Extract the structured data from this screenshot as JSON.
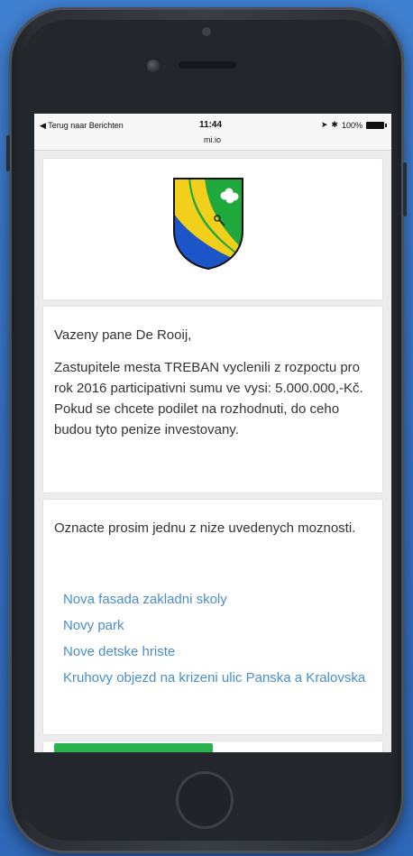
{
  "status_bar": {
    "back_label": "◀ Terug naar Berichten",
    "time": "11:44",
    "host": "mi.io",
    "battery_label": "100%"
  },
  "logo": {
    "name": "municipal-crest"
  },
  "message": {
    "greeting": "Vazeny pane De Rooij,",
    "body": "Zastupitele mesta TREBAN vyclenili z rozpoctu pro rok 2016 participativni sumu ve vysi: 5.000.000,-Kč. Pokud se chcete podilet na rozhodnuti, do ceho budou tyto penize investovany."
  },
  "poll": {
    "prompt": "Oznacte prosim jednu z nize uvedenych moznosti.",
    "options": [
      "Nova fasada zakladni skoly",
      "Novy park",
      "Nove detske hriste",
      "Kruhovy objezd na krizeni ulic Panska a Kralovska"
    ]
  },
  "colors": {
    "background": "#3573c4",
    "link": "#4a8ec9",
    "button_green": "#2bb24c",
    "crest_green": "#1fa83b",
    "crest_yellow": "#f2cf1a",
    "crest_blue": "#1b55c8"
  }
}
